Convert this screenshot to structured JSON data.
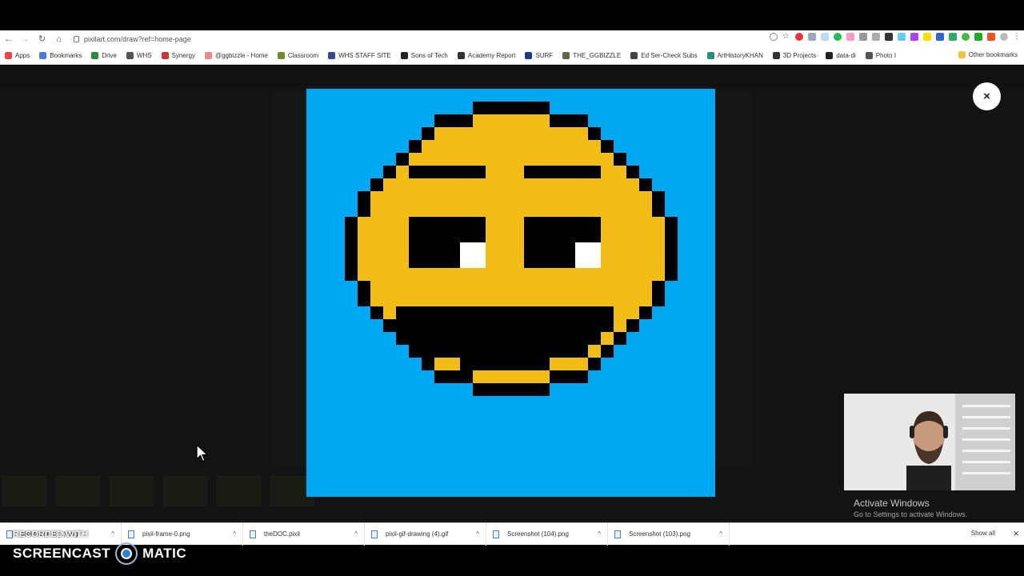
{
  "browser": {
    "url": "pixilart.com/draw?ref=home-page",
    "bookmarks": [
      {
        "label": "Apps",
        "color": "#e44"
      },
      {
        "label": "Bookmarks",
        "color": "#4a7ddc"
      },
      {
        "label": "Drive",
        "color": "#2a8d3a"
      },
      {
        "label": "WHS",
        "color": "#555"
      },
      {
        "label": "Synergy",
        "color": "#c33"
      },
      {
        "label": "@ggbizzle - Home",
        "color": "#e88"
      },
      {
        "label": "Classroom",
        "color": "#6a8f2a"
      },
      {
        "label": "WHS STAFF SITE",
        "color": "#33489a"
      },
      {
        "label": "Sons of Tech",
        "color": "#222"
      },
      {
        "label": "Academy Report",
        "color": "#333"
      },
      {
        "label": "SURF",
        "color": "#1c3a8a"
      },
      {
        "label": "THE_GGBIZZLE",
        "color": "#664"
      },
      {
        "label": "Ed Ser-Check Subs",
        "color": "#444"
      },
      {
        "label": "ArtHistoryKHAN",
        "color": "#2a8d7a"
      },
      {
        "label": "3D Projects",
        "color": "#333"
      },
      {
        "label": "data-di",
        "color": "#222"
      },
      {
        "label": "Photo I",
        "color": "#555"
      }
    ],
    "other_bookmarks": "Other bookmarks"
  },
  "preview": {
    "close_label": "×",
    "background_color": "#00a8f3",
    "face_color": "#f2bd14"
  },
  "watermark": {
    "title": "Activate Windows",
    "subtitle": "Go to Settings to activate Windows."
  },
  "downloads": {
    "items": [
      {
        "name": "pixil-frame-0 (1).png"
      },
      {
        "name": "pixil-frame-0.png"
      },
      {
        "name": "theDOC.pixil"
      },
      {
        "name": "pixil-gif-drawing (4).gif"
      },
      {
        "name": "Screenshot (104).png"
      },
      {
        "name": "Screenshot (103).png"
      }
    ],
    "show_all": "Show all",
    "close": "×"
  },
  "recorder": {
    "recorded_with": "RECORDED WITH",
    "brand_left": "SCREENCAST",
    "brand_right": "MATIC"
  }
}
